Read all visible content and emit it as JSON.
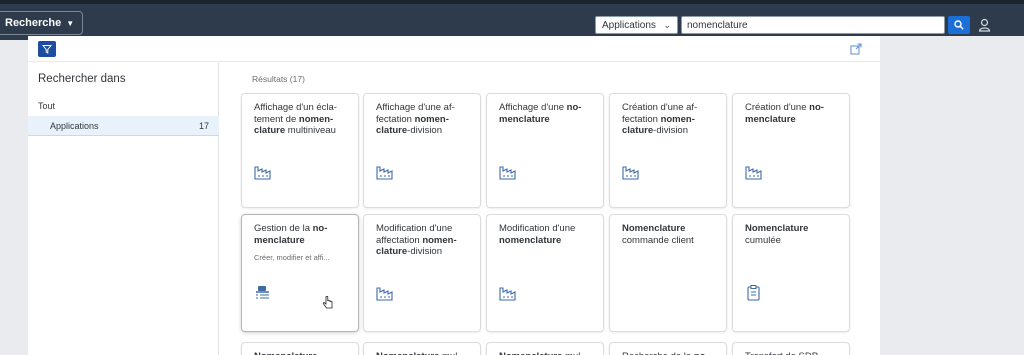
{
  "shell": {
    "app_menu_label": "Recherche",
    "scope_value": "Applications",
    "search_value": "nomenclature"
  },
  "facets": {
    "title": "Rechercher dans",
    "all_label": "Tout",
    "items": [
      {
        "label": "Applications",
        "count": "17",
        "selected": true
      }
    ]
  },
  "results": {
    "count_label": "Résultats (17)",
    "tiles": [
      {
        "title": [
          [
            "Affichage d'un écla- tement de ",
            false
          ],
          [
            "nomen- clature",
            true
          ],
          [
            " multiniveau",
            false
          ]
        ],
        "icon": "factory-icon"
      },
      {
        "title": [
          [
            "Affichage d'une af- fectation ",
            false
          ],
          [
            "nomen- clature",
            true
          ],
          [
            "-division",
            false
          ]
        ],
        "icon": "factory-icon"
      },
      {
        "title": [
          [
            "Affichage d'une ",
            false
          ],
          [
            "no- menclature",
            true
          ]
        ],
        "icon": "factory-icon"
      },
      {
        "title": [
          [
            "Création d'une af- fectation ",
            false
          ],
          [
            "nomen- clature",
            true
          ],
          [
            "-division",
            false
          ]
        ],
        "icon": "factory-icon"
      },
      {
        "title": [
          [
            "Création d'une ",
            false
          ],
          [
            "no- menclature",
            true
          ]
        ],
        "icon": "factory-icon"
      },
      {
        "title": [
          [
            "Gestion de la ",
            false
          ],
          [
            "no- menclature",
            true
          ]
        ],
        "subtitle": "Créer, modifier et affi...",
        "icon": "task-list-icon"
      },
      {
        "title": [
          [
            "Modification d'une affectation ",
            false
          ],
          [
            "nomen- clature",
            true
          ],
          [
            "-division",
            false
          ]
        ],
        "icon": "factory-icon"
      },
      {
        "title": [
          [
            "Modification d'une ",
            false
          ],
          [
            "nomenclature",
            true
          ]
        ],
        "icon": "factory-icon"
      },
      {
        "title": [
          [
            "Nomenclature",
            true
          ],
          [
            " commande client",
            false
          ]
        ],
        "icon": ""
      },
      {
        "title": [
          [
            "Nomenclature",
            true
          ],
          [
            " cumulée",
            false
          ]
        ],
        "icon": "clipboard-icon"
      },
      {
        "title": [
          [
            "Nomenclature",
            true
          ]
        ],
        "icon": ""
      },
      {
        "title": [
          [
            "Nomenclature",
            true
          ],
          [
            " mul-",
            false
          ]
        ],
        "icon": ""
      },
      {
        "title": [
          [
            "Nomenclature",
            true
          ],
          [
            " mul-",
            false
          ]
        ],
        "icon": ""
      },
      {
        "title": [
          [
            "Recherche de la ",
            false
          ],
          [
            "no-",
            true
          ]
        ],
        "icon": ""
      },
      {
        "title": [
          [
            "Transfert de SDP",
            false
          ]
        ],
        "icon": ""
      }
    ]
  },
  "colors": {
    "shell_bg": "#2d3b4c",
    "accent_blue": "#1d6fd8",
    "filter_blue": "#1c4d9e",
    "icon_blue": "#3e6aa8",
    "facet_selected_bg": "#e9f1fa"
  }
}
